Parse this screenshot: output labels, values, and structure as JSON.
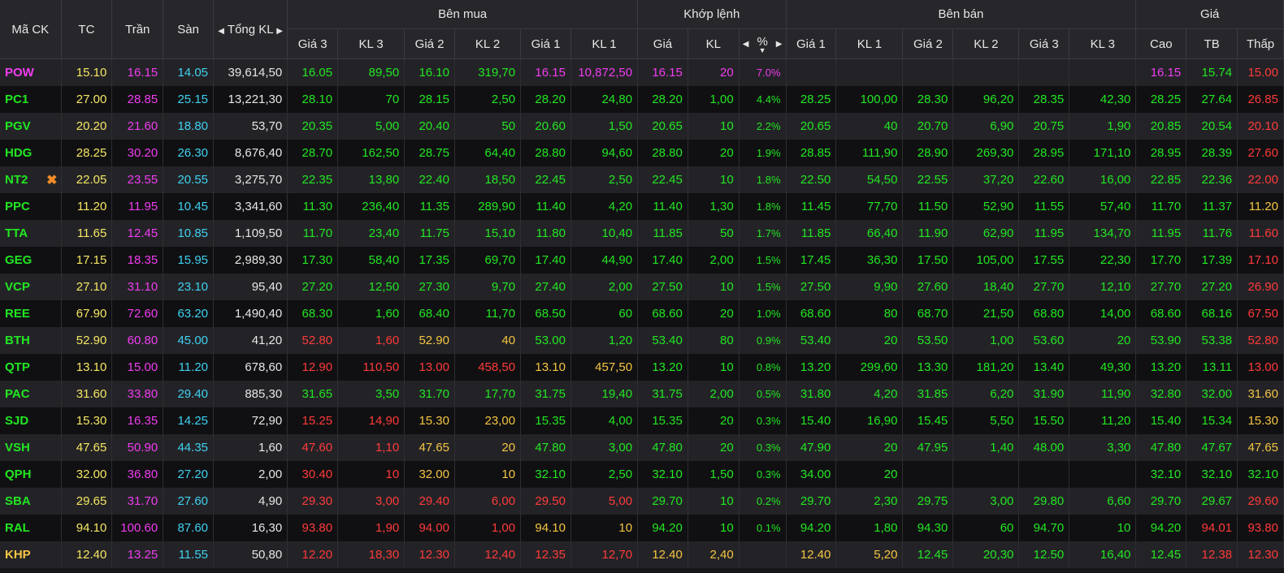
{
  "header": {
    "symbol": "Mã CK",
    "ref": "TC",
    "ceil": "Trần",
    "floor": "Sàn",
    "total_volume": "Tổng KL",
    "buy_group": "Bên mua",
    "match_group": "Khớp lệnh",
    "sell_group": "Bên bán",
    "price_group": "Giá",
    "buy_cols": [
      "Giá 3",
      "KL 3",
      "Giá 2",
      "KL 2",
      "Giá 1",
      "KL 1"
    ],
    "match_cols": [
      "Giá",
      "KL",
      "%"
    ],
    "sell_cols": [
      "Giá 1",
      "KL 1",
      "Giá 2",
      "KL 2",
      "Giá 3",
      "KL 3"
    ],
    "price_cols": [
      "Cao",
      "TB",
      "Thấp"
    ]
  },
  "colors": {
    "up": "#22e622",
    "down": "#ff3a3a",
    "reference": "#f5c542",
    "ceiling": "#f03cf0",
    "floor": "#3fd1f0"
  },
  "icons": {
    "remove": "close-x-icon",
    "sort": "sort-desc-icon",
    "arrow_left": "caret-left-icon",
    "arrow_right": "caret-right-icon"
  },
  "rows": [
    {
      "sym": "POW",
      "sc": "ceil",
      "tc": "15.10",
      "ceil": "16.15",
      "floor": "14.05",
      "vol": "39,614,50",
      "b3": "16.05",
      "b3c": "up",
      "bv3": "89,50",
      "b2": "16.10",
      "b2c": "up",
      "bv2": "319,70",
      "b1": "16.15",
      "b1c": "ceil",
      "bv1": "10,872,50",
      "mp": "16.15",
      "mpc": "ceil",
      "mv": "20",
      "pct": "7.0%",
      "s1": "",
      "s1c": "up",
      "sv1": "",
      "s2": "",
      "s2c": "up",
      "sv2": "",
      "s3": "",
      "s3c": "up",
      "sv3": "",
      "hi": "16.15",
      "hic": "ceil",
      "avg": "15.74",
      "avgc": "up",
      "lo": "15.00",
      "loc": "down"
    },
    {
      "sym": "PC1",
      "sc": "up",
      "tc": "27.00",
      "ceil": "28.85",
      "floor": "25.15",
      "vol": "13,221,30",
      "b3": "28.10",
      "b3c": "up",
      "bv3": "70",
      "b2": "28.15",
      "b2c": "up",
      "bv2": "2,50",
      "b1": "28.20",
      "b1c": "up",
      "bv1": "24,80",
      "mp": "28.20",
      "mpc": "up",
      "mv": "1,00",
      "pct": "4.4%",
      "s1": "28.25",
      "s1c": "up",
      "sv1": "100,00",
      "s2": "28.30",
      "s2c": "up",
      "sv2": "96,20",
      "s3": "28.35",
      "s3c": "up",
      "sv3": "42,30",
      "hi": "28.25",
      "hic": "up",
      "avg": "27.64",
      "avgc": "up",
      "lo": "26.85",
      "loc": "down"
    },
    {
      "sym": "PGV",
      "sc": "up",
      "tc": "20.20",
      "ceil": "21.60",
      "floor": "18.80",
      "vol": "53,70",
      "b3": "20.35",
      "b3c": "up",
      "bv3": "5,00",
      "b2": "20.40",
      "b2c": "up",
      "bv2": "50",
      "b1": "20.60",
      "b1c": "up",
      "bv1": "1,50",
      "mp": "20.65",
      "mpc": "up",
      "mv": "10",
      "pct": "2.2%",
      "s1": "20.65",
      "s1c": "up",
      "sv1": "40",
      "s2": "20.70",
      "s2c": "up",
      "sv2": "6,90",
      "s3": "20.75",
      "s3c": "up",
      "sv3": "1,90",
      "hi": "20.85",
      "hic": "up",
      "avg": "20.54",
      "avgc": "up",
      "lo": "20.10",
      "loc": "down"
    },
    {
      "sym": "HDG",
      "sc": "up",
      "tc": "28.25",
      "ceil": "30.20",
      "floor": "26.30",
      "vol": "8,676,40",
      "b3": "28.70",
      "b3c": "up",
      "bv3": "162,50",
      "b2": "28.75",
      "b2c": "up",
      "bv2": "64,40",
      "b1": "28.80",
      "b1c": "up",
      "bv1": "94,60",
      "mp": "28.80",
      "mpc": "up",
      "mv": "20",
      "pct": "1.9%",
      "s1": "28.85",
      "s1c": "up",
      "sv1": "111,90",
      "s2": "28.90",
      "s2c": "up",
      "sv2": "269,30",
      "s3": "28.95",
      "s3c": "up",
      "sv3": "171,10",
      "hi": "28.95",
      "hic": "up",
      "avg": "28.39",
      "avgc": "up",
      "lo": "27.60",
      "loc": "down"
    },
    {
      "sym": "NT2",
      "sc": "up",
      "x": true,
      "tc": "22.05",
      "ceil": "23.55",
      "floor": "20.55",
      "vol": "3,275,70",
      "b3": "22.35",
      "b3c": "up",
      "bv3": "13,80",
      "b2": "22.40",
      "b2c": "up",
      "bv2": "18,50",
      "b1": "22.45",
      "b1c": "up",
      "bv1": "2,50",
      "mp": "22.45",
      "mpc": "up",
      "mv": "10",
      "pct": "1.8%",
      "s1": "22.50",
      "s1c": "up",
      "sv1": "54,50",
      "s2": "22.55",
      "s2c": "up",
      "sv2": "37,20",
      "s3": "22.60",
      "s3c": "up",
      "sv3": "16,00",
      "hi": "22.85",
      "hic": "up",
      "avg": "22.36",
      "avgc": "up",
      "lo": "22.00",
      "loc": "down"
    },
    {
      "sym": "PPC",
      "sc": "up",
      "tc": "11.20",
      "ceil": "11.95",
      "floor": "10.45",
      "vol": "3,341,60",
      "b3": "11.30",
      "b3c": "up",
      "bv3": "236,40",
      "b2": "11.35",
      "b2c": "up",
      "bv2": "289,90",
      "b1": "11.40",
      "b1c": "up",
      "bv1": "4,20",
      "mp": "11.40",
      "mpc": "up",
      "mv": "1,30",
      "pct": "1.8%",
      "s1": "11.45",
      "s1c": "up",
      "sv1": "77,70",
      "s2": "11.50",
      "s2c": "up",
      "sv2": "52,90",
      "s3": "11.55",
      "s3c": "up",
      "sv3": "57,40",
      "hi": "11.70",
      "hic": "up",
      "avg": "11.37",
      "avgc": "up",
      "lo": "11.20",
      "loc": "ref"
    },
    {
      "sym": "TTA",
      "sc": "up",
      "tc": "11.65",
      "ceil": "12.45",
      "floor": "10.85",
      "vol": "1,109,50",
      "b3": "11.70",
      "b3c": "up",
      "bv3": "23,40",
      "b2": "11.75",
      "b2c": "up",
      "bv2": "15,10",
      "b1": "11.80",
      "b1c": "up",
      "bv1": "10,40",
      "mp": "11.85",
      "mpc": "up",
      "mv": "50",
      "pct": "1.7%",
      "s1": "11.85",
      "s1c": "up",
      "sv1": "66,40",
      "s2": "11.90",
      "s2c": "up",
      "sv2": "62,90",
      "s3": "11.95",
      "s3c": "up",
      "sv3": "134,70",
      "hi": "11.95",
      "hic": "up",
      "avg": "11.76",
      "avgc": "up",
      "lo": "11.60",
      "loc": "down"
    },
    {
      "sym": "GEG",
      "sc": "up",
      "tc": "17.15",
      "ceil": "18.35",
      "floor": "15.95",
      "vol": "2,989,30",
      "b3": "17.30",
      "b3c": "up",
      "bv3": "58,40",
      "b2": "17.35",
      "b2c": "up",
      "bv2": "69,70",
      "b1": "17.40",
      "b1c": "up",
      "bv1": "44,90",
      "mp": "17.40",
      "mpc": "up",
      "mv": "2,00",
      "pct": "1.5%",
      "s1": "17.45",
      "s1c": "up",
      "sv1": "36,30",
      "s2": "17.50",
      "s2c": "up",
      "sv2": "105,00",
      "s3": "17.55",
      "s3c": "up",
      "sv3": "22,30",
      "hi": "17.70",
      "hic": "up",
      "avg": "17.39",
      "avgc": "up",
      "lo": "17.10",
      "loc": "down"
    },
    {
      "sym": "VCP",
      "sc": "up",
      "tc": "27.10",
      "ceil": "31.10",
      "floor": "23.10",
      "vol": "95,40",
      "b3": "27.20",
      "b3c": "up",
      "bv3": "12,50",
      "b2": "27.30",
      "b2c": "up",
      "bv2": "9,70",
      "b1": "27.40",
      "b1c": "up",
      "bv1": "2,00",
      "mp": "27.50",
      "mpc": "up",
      "mv": "10",
      "pct": "1.5%",
      "s1": "27.50",
      "s1c": "up",
      "sv1": "9,90",
      "s2": "27.60",
      "s2c": "up",
      "sv2": "18,40",
      "s3": "27.70",
      "s3c": "up",
      "sv3": "12,10",
      "hi": "27.70",
      "hic": "up",
      "avg": "27.20",
      "avgc": "up",
      "lo": "26.90",
      "loc": "down"
    },
    {
      "sym": "REE",
      "sc": "up",
      "tc": "67.90",
      "ceil": "72.60",
      "floor": "63.20",
      "vol": "1,490,40",
      "b3": "68.30",
      "b3c": "up",
      "bv3": "1,60",
      "b2": "68.40",
      "b2c": "up",
      "bv2": "11,70",
      "b1": "68.50",
      "b1c": "up",
      "bv1": "60",
      "mp": "68.60",
      "mpc": "up",
      "mv": "20",
      "pct": "1.0%",
      "s1": "68.60",
      "s1c": "up",
      "sv1": "80",
      "s2": "68.70",
      "s2c": "up",
      "sv2": "21,50",
      "s3": "68.80",
      "s3c": "up",
      "sv3": "14,00",
      "hi": "68.60",
      "hic": "up",
      "avg": "68.16",
      "avgc": "up",
      "lo": "67.50",
      "loc": "down"
    },
    {
      "sym": "BTH",
      "sc": "up",
      "tc": "52.90",
      "ceil": "60.80",
      "floor": "45.00",
      "vol": "41,20",
      "b3": "52.80",
      "b3c": "down",
      "bv3": "1,60",
      "b2": "52.90",
      "b2c": "ref",
      "bv2": "40",
      "b1": "53.00",
      "b1c": "up",
      "bv1": "1,20",
      "mp": "53.40",
      "mpc": "up",
      "mv": "80",
      "pct": "0.9%",
      "s1": "53.40",
      "s1c": "up",
      "sv1": "20",
      "s2": "53.50",
      "s2c": "up",
      "sv2": "1,00",
      "s3": "53.60",
      "s3c": "up",
      "sv3": "20",
      "hi": "53.90",
      "hic": "up",
      "avg": "53.38",
      "avgc": "up",
      "lo": "52.80",
      "loc": "down"
    },
    {
      "sym": "QTP",
      "sc": "up",
      "tc": "13.10",
      "ceil": "15.00",
      "floor": "11.20",
      "vol": "678,60",
      "b3": "12.90",
      "b3c": "down",
      "bv3": "110,50",
      "b2": "13.00",
      "b2c": "down",
      "bv2": "458,50",
      "b1": "13.10",
      "b1c": "ref",
      "bv1": "457,50",
      "mp": "13.20",
      "mpc": "up",
      "mv": "10",
      "pct": "0.8%",
      "s1": "13.20",
      "s1c": "up",
      "sv1": "299,60",
      "s2": "13.30",
      "s2c": "up",
      "sv2": "181,20",
      "s3": "13.40",
      "s3c": "up",
      "sv3": "49,30",
      "hi": "13.20",
      "hic": "up",
      "avg": "13.11",
      "avgc": "up",
      "lo": "13.00",
      "loc": "down"
    },
    {
      "sym": "PAC",
      "sc": "up",
      "tc": "31.60",
      "ceil": "33.80",
      "floor": "29.40",
      "vol": "885,30",
      "b3": "31.65",
      "b3c": "up",
      "bv3": "3,50",
      "b2": "31.70",
      "b2c": "up",
      "bv2": "17,70",
      "b1": "31.75",
      "b1c": "up",
      "bv1": "19,40",
      "mp": "31.75",
      "mpc": "up",
      "mv": "2,00",
      "pct": "0.5%",
      "s1": "31.80",
      "s1c": "up",
      "sv1": "4,20",
      "s2": "31.85",
      "s2c": "up",
      "sv2": "6,20",
      "s3": "31.90",
      "s3c": "up",
      "sv3": "11,90",
      "hi": "32.80",
      "hic": "up",
      "avg": "32.00",
      "avgc": "up",
      "lo": "31.60",
      "loc": "ref"
    },
    {
      "sym": "SJD",
      "sc": "up",
      "tc": "15.30",
      "ceil": "16.35",
      "floor": "14.25",
      "vol": "72,90",
      "b3": "15.25",
      "b3c": "down",
      "bv3": "14,90",
      "b2": "15.30",
      "b2c": "ref",
      "bv2": "23,00",
      "b1": "15.35",
      "b1c": "up",
      "bv1": "4,00",
      "mp": "15.35",
      "mpc": "up",
      "mv": "20",
      "pct": "0.3%",
      "s1": "15.40",
      "s1c": "up",
      "sv1": "16,90",
      "s2": "15.45",
      "s2c": "up",
      "sv2": "5,50",
      "s3": "15.50",
      "s3c": "up",
      "sv3": "11,20",
      "hi": "15.40",
      "hic": "up",
      "avg": "15.34",
      "avgc": "up",
      "lo": "15.30",
      "loc": "ref"
    },
    {
      "sym": "VSH",
      "sc": "up",
      "tc": "47.65",
      "ceil": "50.90",
      "floor": "44.35",
      "vol": "1,60",
      "b3": "47.60",
      "b3c": "down",
      "bv3": "1,10",
      "b2": "47.65",
      "b2c": "ref",
      "bv2": "20",
      "b1": "47.80",
      "b1c": "up",
      "bv1": "3,00",
      "mp": "47.80",
      "mpc": "up",
      "mv": "20",
      "pct": "0.3%",
      "s1": "47.90",
      "s1c": "up",
      "sv1": "20",
      "s2": "47.95",
      "s2c": "up",
      "sv2": "1,40",
      "s3": "48.00",
      "s3c": "up",
      "sv3": "3,30",
      "hi": "47.80",
      "hic": "up",
      "avg": "47.67",
      "avgc": "up",
      "lo": "47.65",
      "loc": "ref"
    },
    {
      "sym": "QPH",
      "sc": "up",
      "tc": "32.00",
      "ceil": "36.80",
      "floor": "27.20",
      "vol": "2,00",
      "b3": "30.40",
      "b3c": "down",
      "bv3": "10",
      "b2": "32.00",
      "b2c": "ref",
      "bv2": "10",
      "b1": "32.10",
      "b1c": "up",
      "bv1": "2,50",
      "mp": "32.10",
      "mpc": "up",
      "mv": "1,50",
      "pct": "0.3%",
      "s1": "34.00",
      "s1c": "up",
      "sv1": "20",
      "s2": "",
      "s2c": "up",
      "sv2": "",
      "s3": "",
      "s3c": "up",
      "sv3": "",
      "hi": "32.10",
      "hic": "up",
      "avg": "32.10",
      "avgc": "up",
      "lo": "32.10",
      "loc": "up"
    },
    {
      "sym": "SBA",
      "sc": "up",
      "tc": "29.65",
      "ceil": "31.70",
      "floor": "27.60",
      "vol": "4,90",
      "b3": "29.30",
      "b3c": "down",
      "bv3": "3,00",
      "b2": "29.40",
      "b2c": "down",
      "bv2": "6,00",
      "b1": "29.50",
      "b1c": "down",
      "bv1": "5,00",
      "mp": "29.70",
      "mpc": "up",
      "mv": "10",
      "pct": "0.2%",
      "s1": "29.70",
      "s1c": "up",
      "sv1": "2,30",
      "s2": "29.75",
      "s2c": "up",
      "sv2": "3,00",
      "s3": "29.80",
      "s3c": "up",
      "sv3": "6,60",
      "hi": "29.70",
      "hic": "up",
      "avg": "29.67",
      "avgc": "up",
      "lo": "29.60",
      "loc": "down"
    },
    {
      "sym": "RAL",
      "sc": "up",
      "tc": "94.10",
      "ceil": "100.60",
      "floor": "87.60",
      "vol": "16,30",
      "b3": "93.80",
      "b3c": "down",
      "bv3": "1,90",
      "b2": "94.00",
      "b2c": "down",
      "bv2": "1,00",
      "b1": "94.10",
      "b1c": "ref",
      "bv1": "10",
      "mp": "94.20",
      "mpc": "up",
      "mv": "10",
      "pct": "0.1%",
      "s1": "94.20",
      "s1c": "up",
      "sv1": "1,80",
      "s2": "94.30",
      "s2c": "up",
      "sv2": "60",
      "s3": "94.70",
      "s3c": "up",
      "sv3": "10",
      "hi": "94.20",
      "hic": "up",
      "avg": "94.01",
      "avgc": "down",
      "lo": "93.80",
      "loc": "down"
    },
    {
      "sym": "KHP",
      "sc": "ref",
      "tc": "12.40",
      "ceil": "13.25",
      "floor": "11.55",
      "vol": "50,80",
      "b3": "12.20",
      "b3c": "down",
      "bv3": "18,30",
      "b2": "12.30",
      "b2c": "down",
      "bv2": "12,40",
      "b1": "12.35",
      "b1c": "down",
      "bv1": "12,70",
      "mp": "12.40",
      "mpc": "ref",
      "mv": "2,40",
      "pct": "",
      "s1": "12.40",
      "s1c": "ref",
      "sv1": "5,20",
      "s2": "12.45",
      "s2c": "up",
      "sv2": "20,30",
      "s3": "12.50",
      "s3c": "up",
      "sv3": "16,40",
      "hi": "12.45",
      "hic": "up",
      "avg": "12.38",
      "avgc": "down",
      "lo": "12.30",
      "loc": "down"
    }
  ]
}
